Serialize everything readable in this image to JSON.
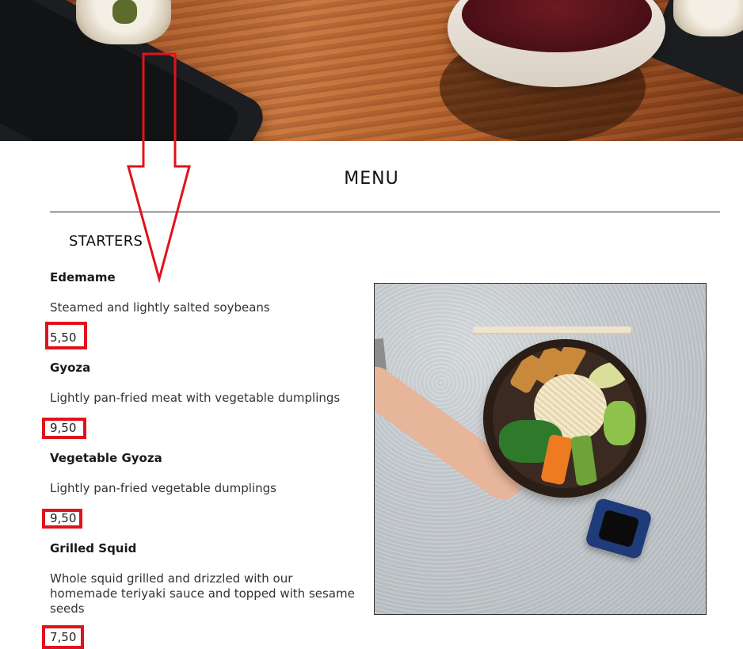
{
  "menu": {
    "title": "MENU",
    "section": "STARTERS",
    "items": [
      {
        "name": "Edemame",
        "description": "Steamed and lightly salted soybeans",
        "price": "5,50"
      },
      {
        "name": "Gyoza",
        "description": "Lightly pan-fried meat with vegetable dumplings",
        "price": "9,50"
      },
      {
        "name": "Vegetable Gyoza",
        "description": "Lightly pan-fried vegetable dumplings",
        "price": "9,50"
      },
      {
        "name": "Grilled Squid",
        "description": "Whole squid grilled and drizzled with our homemade teriyaki sauce and topped with sesame seeds",
        "price": "7,50"
      }
    ]
  },
  "annotation": {
    "color": "#e0131b"
  }
}
